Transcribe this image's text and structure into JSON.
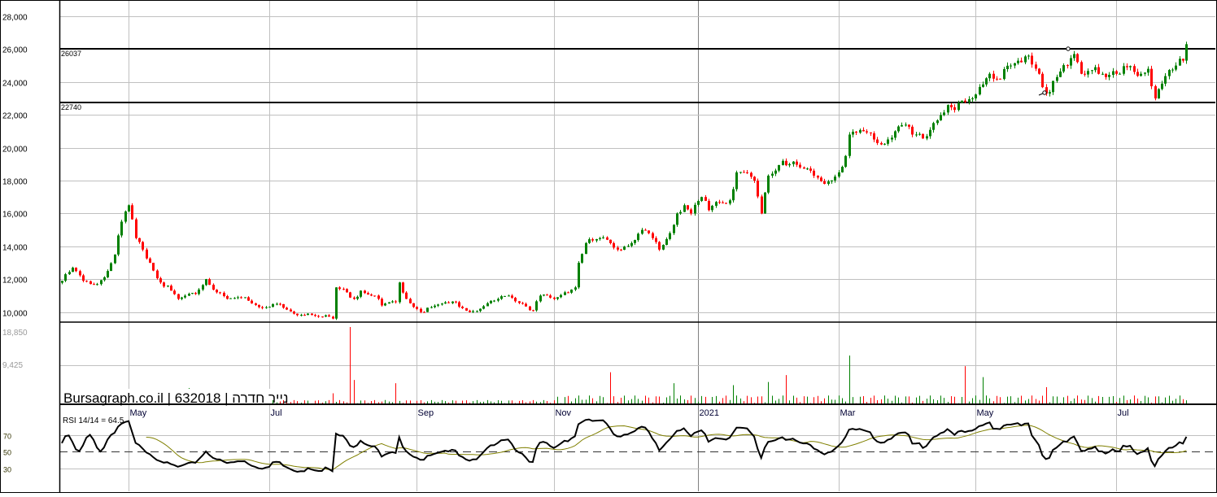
{
  "watermark": "Bursagraph.co.il | 632018 | נייר חדרה",
  "chart_data": {
    "type": "candlestick",
    "title": "",
    "security_id": "632018",
    "security_name": "נייר חדרה",
    "price_axis": {
      "ticks": [
        "28,000",
        "26,000",
        "24,000",
        "22,000",
        "20,000",
        "18,000",
        "16,000",
        "14,000",
        "12,000",
        "10,000"
      ],
      "tick_values": [
        28000,
        26000,
        24000,
        22000,
        20000,
        18000,
        16000,
        14000,
        12000,
        10000
      ],
      "ylim": [
        9400,
        28900
      ]
    },
    "x_labels": [
      "May",
      "Jul",
      "Sep",
      "Nov",
      "2021",
      "Mar",
      "May",
      "Jul"
    ],
    "x_label_day_index": [
      19,
      59,
      101,
      140,
      181,
      221,
      260,
      300
    ],
    "horizontal_levels": [
      {
        "value": 26037,
        "label": "26037"
      },
      {
        "value": 22740,
        "label": "22740"
      }
    ],
    "close_path_waypoints": [
      [
        0,
        11900
      ],
      [
        3,
        12700
      ],
      [
        6,
        11900
      ],
      [
        10,
        11700
      ],
      [
        13,
        12500
      ],
      [
        15,
        13500
      ],
      [
        17,
        15500
      ],
      [
        19,
        16500
      ],
      [
        21,
        14500
      ],
      [
        23,
        13800
      ],
      [
        25,
        13000
      ],
      [
        28,
        11800
      ],
      [
        31,
        11300
      ],
      [
        33,
        10800
      ],
      [
        38,
        11100
      ],
      [
        41,
        12000
      ],
      [
        44,
        11200
      ],
      [
        47,
        10800
      ],
      [
        52,
        10900
      ],
      [
        56,
        10300
      ],
      [
        61,
        10500
      ],
      [
        66,
        9900
      ],
      [
        70,
        9900
      ],
      [
        75,
        9800
      ],
      [
        77,
        9600
      ],
      [
        78,
        11500
      ],
      [
        81,
        11200
      ],
      [
        83,
        10800
      ],
      [
        85,
        11300
      ],
      [
        89,
        11000
      ],
      [
        91,
        10400
      ],
      [
        95,
        10600
      ],
      [
        96,
        11800
      ],
      [
        98,
        10800
      ],
      [
        102,
        10000
      ],
      [
        105,
        10300
      ],
      [
        112,
        10600
      ],
      [
        116,
        10000
      ],
      [
        119,
        10200
      ],
      [
        124,
        10800
      ],
      [
        127,
        11000
      ],
      [
        131,
        10500
      ],
      [
        134,
        10100
      ],
      [
        136,
        11000
      ],
      [
        140,
        10800
      ],
      [
        143,
        11200
      ],
      [
        146,
        11500
      ],
      [
        147,
        13000
      ],
      [
        149,
        14200
      ],
      [
        153,
        14500
      ],
      [
        155,
        14400
      ],
      [
        158,
        13800
      ],
      [
        162,
        14200
      ],
      [
        165,
        15000
      ],
      [
        168,
        14500
      ],
      [
        170,
        13800
      ],
      [
        173,
        14800
      ],
      [
        175,
        16000
      ],
      [
        177,
        16500
      ],
      [
        179,
        16000
      ],
      [
        182,
        17000
      ],
      [
        184,
        16200
      ],
      [
        186,
        16700
      ],
      [
        190,
        16800
      ],
      [
        192,
        18500
      ],
      [
        194,
        18500
      ],
      [
        197,
        18000
      ],
      [
        199,
        16000
      ],
      [
        201,
        18300
      ],
      [
        205,
        19200
      ],
      [
        207,
        19000
      ],
      [
        210,
        18800
      ],
      [
        214,
        18300
      ],
      [
        217,
        17800
      ],
      [
        221,
        18500
      ],
      [
        223,
        19500
      ],
      [
        224,
        20800
      ],
      [
        228,
        21000
      ],
      [
        231,
        20500
      ],
      [
        233,
        20200
      ],
      [
        237,
        21000
      ],
      [
        240,
        21400
      ],
      [
        242,
        20800
      ],
      [
        246,
        20700
      ],
      [
        248,
        21500
      ],
      [
        252,
        22600
      ],
      [
        254,
        22300
      ],
      [
        257,
        22800
      ],
      [
        259,
        23000
      ],
      [
        261,
        23700
      ],
      [
        264,
        24500
      ],
      [
        266,
        24200
      ],
      [
        270,
        25000
      ],
      [
        273,
        25200
      ],
      [
        275,
        25600
      ],
      [
        278,
        24500
      ],
      [
        280,
        23300
      ],
      [
        283,
        24300
      ],
      [
        286,
        25000
      ],
      [
        288,
        25700
      ],
      [
        290,
        24500
      ],
      [
        294,
        24900
      ],
      [
        297,
        24300
      ],
      [
        301,
        24500
      ],
      [
        303,
        24900
      ],
      [
        307,
        24500
      ],
      [
        309,
        24800
      ],
      [
        311,
        23000
      ],
      [
        313,
        23900
      ],
      [
        317,
        25000
      ],
      [
        319,
        25300
      ],
      [
        320,
        26300
      ]
    ],
    "volume_axis": {
      "ticks": [
        "18,850",
        "9,425"
      ],
      "tick_values": [
        18850,
        9425
      ]
    },
    "volume_spikes": [
      [
        36,
        3800
      ],
      [
        77,
        2500
      ],
      [
        82,
        18850
      ],
      [
        83,
        5800
      ],
      [
        95,
        5000
      ],
      [
        156,
        7700
      ],
      [
        174,
        5000
      ],
      [
        191,
        4500
      ],
      [
        201,
        5300
      ],
      [
        206,
        7000
      ],
      [
        224,
        11800
      ],
      [
        257,
        9200
      ],
      [
        262,
        6500
      ],
      [
        280,
        4000
      ]
    ],
    "rsi": {
      "label": "RSI 14/14 = 64.5",
      "period": 14,
      "ma_period": 14,
      "ticks": [
        "70",
        "50",
        "30"
      ],
      "tick_values": [
        70,
        50,
        30
      ],
      "reference_level": 50
    },
    "colors": {
      "up": "#008000",
      "down": "#ff0000",
      "rsi_line": "#000000",
      "rsi_ma": "#808000",
      "grid": "#c0c0c0"
    }
  }
}
